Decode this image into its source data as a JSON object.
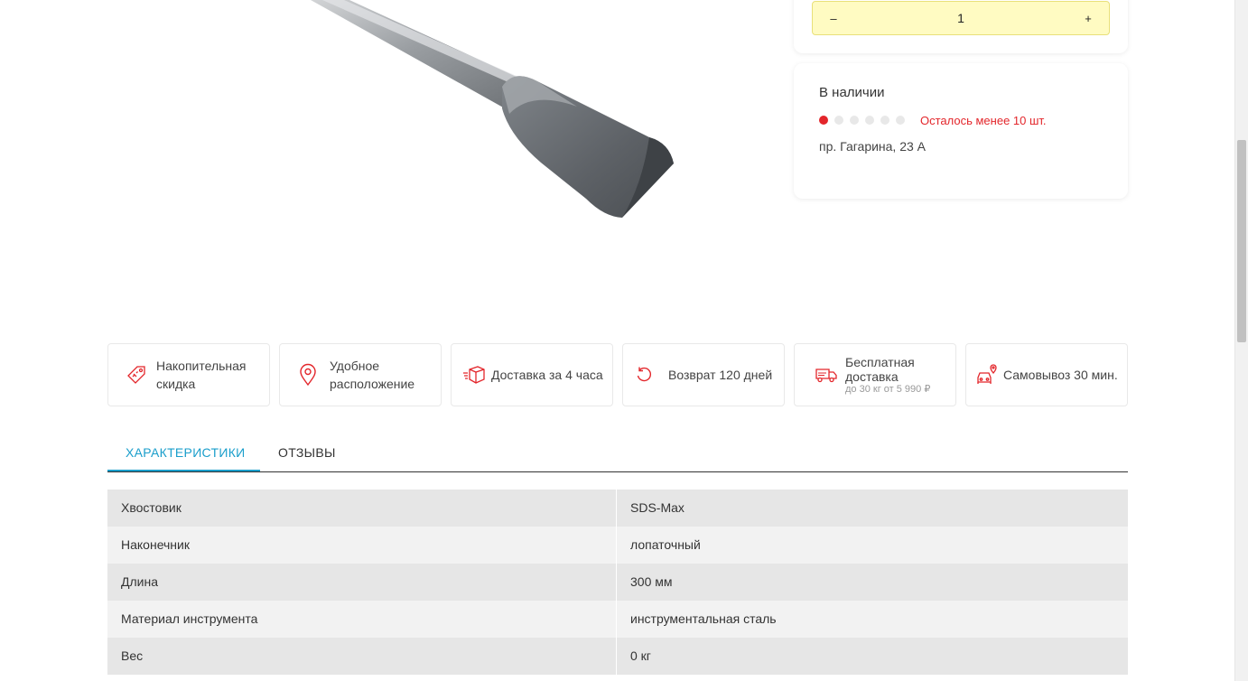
{
  "quantity": {
    "minus_label": "–",
    "value": "1",
    "plus_label": "+"
  },
  "stock": {
    "title": "В наличии",
    "level_dots": {
      "total": 6,
      "filled": 1
    },
    "note": "Осталось менее 10 шт.",
    "address": "пр. Гагарина, 23 А",
    "accent_color": "#e3262b"
  },
  "features": [
    {
      "icon": "discount-tag-icon",
      "label": "Накопительная скидка"
    },
    {
      "icon": "location-pin-icon",
      "label": "Удобное расположение"
    },
    {
      "icon": "delivery-box-icon",
      "label": "Доставка за 4 часа"
    },
    {
      "icon": "return-arrow-icon",
      "label": "Возврат 120 дней"
    },
    {
      "icon": "free-delivery-truck-icon",
      "label": "Бесплатная доставка",
      "sublabel": "до 30 кг от 5 990 ₽"
    },
    {
      "icon": "pickup-car-icon",
      "label": "Самовывоз 30 мин."
    }
  ],
  "tabs": [
    {
      "label": "ХАРАКТЕРИСТИКИ",
      "active": true
    },
    {
      "label": "ОТЗЫВЫ",
      "active": false
    }
  ],
  "specs": [
    {
      "name": "Хвостовик",
      "value": "SDS-Max"
    },
    {
      "name": "Наконечник",
      "value": "лопаточный"
    },
    {
      "name": "Длина",
      "value": "300 мм"
    },
    {
      "name": "Материал инструмента",
      "value": "инструментальная сталь"
    },
    {
      "name": "Вес",
      "value": "0 кг"
    }
  ],
  "colors": {
    "accent_blue": "#1a9ecb",
    "accent_red": "#e3262b",
    "qty_bg": "#fffbc2"
  }
}
